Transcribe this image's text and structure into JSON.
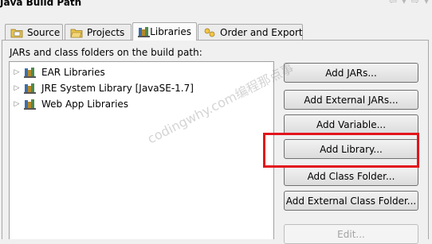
{
  "window": {
    "title": "Java Build Path"
  },
  "tabs": [
    {
      "label": "Source",
      "icon": "source-folder-icon",
      "active": false
    },
    {
      "label": "Projects",
      "icon": "projects-folder-icon",
      "active": false
    },
    {
      "label": "Libraries",
      "icon": "libraries-icon",
      "active": true
    },
    {
      "label": "Order and Export",
      "icon": "order-export-icon",
      "active": false
    }
  ],
  "libraries": {
    "heading": "JARs and class folders on the build path:",
    "items": [
      {
        "label": "EAR Libraries",
        "icon": "library-icon",
        "expanded": false
      },
      {
        "label": "JRE System Library [JavaSE-1.7]",
        "icon": "library-icon",
        "expanded": false
      },
      {
        "label": "Web App Libraries",
        "icon": "library-icon",
        "expanded": false
      }
    ]
  },
  "buttons": [
    {
      "label": "Add JARs...",
      "enabled": true
    },
    {
      "label": "Add External JARs...",
      "enabled": true
    },
    {
      "label": "Add Variable...",
      "enabled": true
    },
    {
      "label": "Add Library...",
      "enabled": true,
      "highlighted": true
    },
    {
      "label": "Add Class Folder...",
      "enabled": true
    },
    {
      "label": "Add External Class Folder...",
      "enabled": true
    },
    {
      "label": "Edit...",
      "enabled": false
    }
  ],
  "watermark": "codingwhy.com编程那点事",
  "colors": {
    "highlight": "#e3141c",
    "tab_bg": "#ececec",
    "panel_bg": "#f0f0f0"
  }
}
